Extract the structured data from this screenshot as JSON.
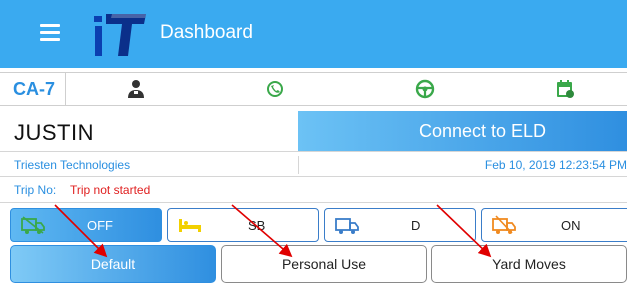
{
  "header": {
    "logo_text": "iT",
    "title": "Dashboard",
    "menu_icon": "hamburger-menu-icon"
  },
  "status_bar": {
    "vehicle_id": "CA-7",
    "icons": [
      "driver-icon",
      "phone-signal-icon",
      "steering-wheel-icon",
      "calendar-icon"
    ]
  },
  "driver": {
    "name": "JUSTIN",
    "company": "Triesten Technologies"
  },
  "eld": {
    "connect_label": "Connect to ELD",
    "datetime": "Feb 10, 2019 12:23:54 PM"
  },
  "trip": {
    "label": "Trip No:",
    "value": "Trip not started"
  },
  "duty_status": [
    {
      "label": "OFF",
      "icon": "truck-off-icon",
      "active": true
    },
    {
      "label": "SB",
      "icon": "sleeper-bed-icon",
      "active": false
    },
    {
      "label": "D",
      "icon": "truck-driving-icon",
      "active": false
    },
    {
      "label": "ON",
      "icon": "truck-on-duty-icon",
      "active": false
    }
  ],
  "modes": [
    {
      "label": "Default",
      "active": true
    },
    {
      "label": "Personal Use",
      "active": false
    },
    {
      "label": "Yard Moves",
      "active": false
    }
  ],
  "colors": {
    "header_bg": "#3aaaf0",
    "accent_blue": "#2a8fe0",
    "trip_red": "#e02020",
    "annotation_arrow": "#e00000"
  }
}
